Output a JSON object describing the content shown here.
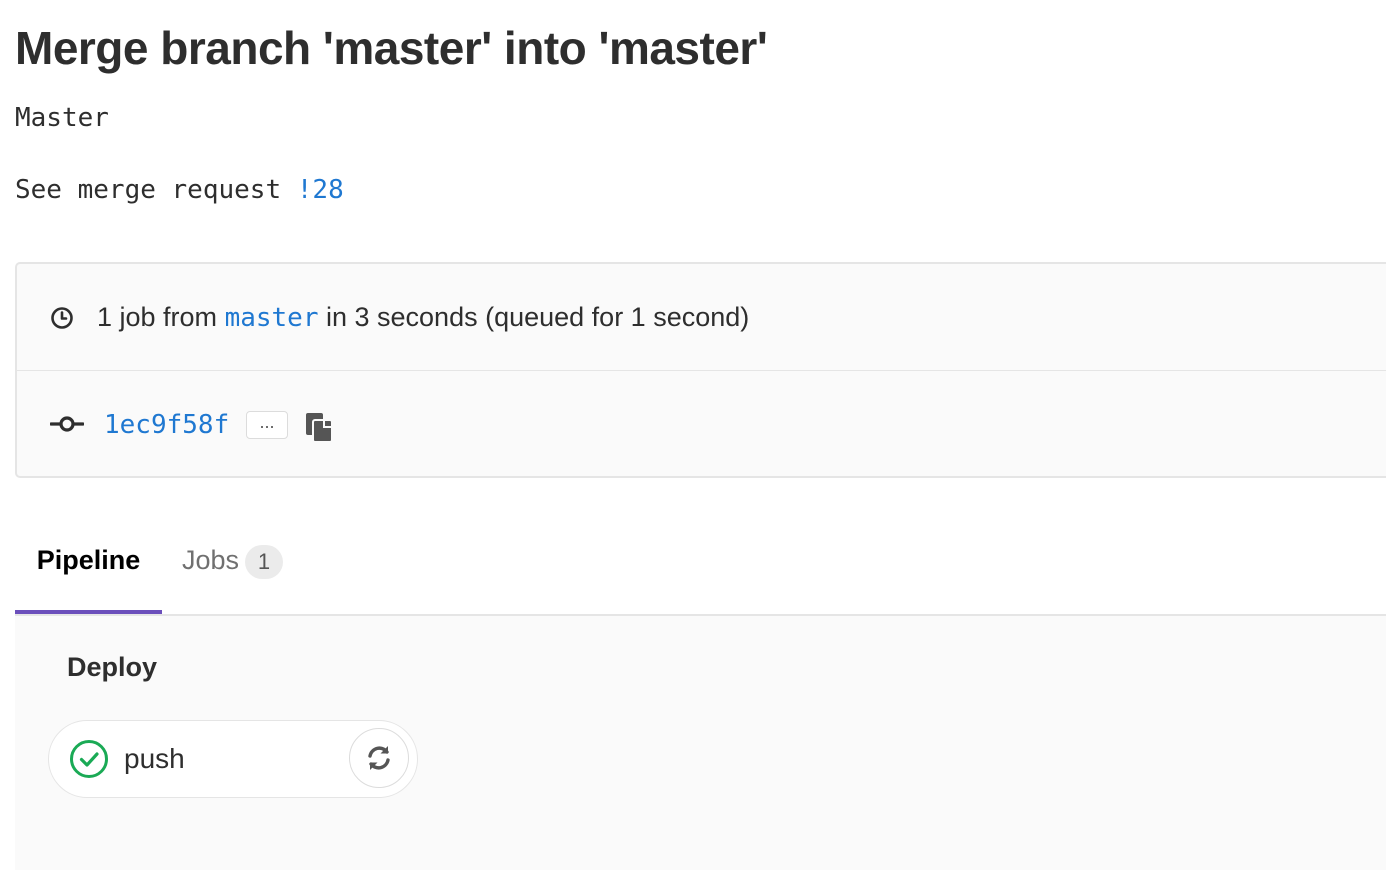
{
  "commit": {
    "title": "Merge branch 'master' into 'master'",
    "description_line_1": "Master",
    "description_prefix": "See merge request ",
    "merge_request_ref": "!28"
  },
  "pipeline_info": {
    "icon": "clock-icon",
    "job_text_pre": "1 job from ",
    "branch": "master",
    "job_text_post": " in 3 seconds (queued for 1 second)",
    "commit_icon": "commit-icon",
    "sha": "1ec9f58f",
    "expand_label": "...",
    "copy_icon": "clipboard-icon"
  },
  "tabs": [
    {
      "label": "Pipeline",
      "active": true
    },
    {
      "label": "Jobs",
      "badge": "1",
      "active": false
    }
  ],
  "stages": [
    {
      "name": "Deploy",
      "jobs": [
        {
          "name": "push",
          "status": "success",
          "status_icon": "check-circle-icon",
          "action_icon": "retry-icon"
        }
      ]
    }
  ],
  "colors": {
    "link": "#1f78d1",
    "active_tab": "#6b4fbb",
    "success": "#1aaa55"
  }
}
